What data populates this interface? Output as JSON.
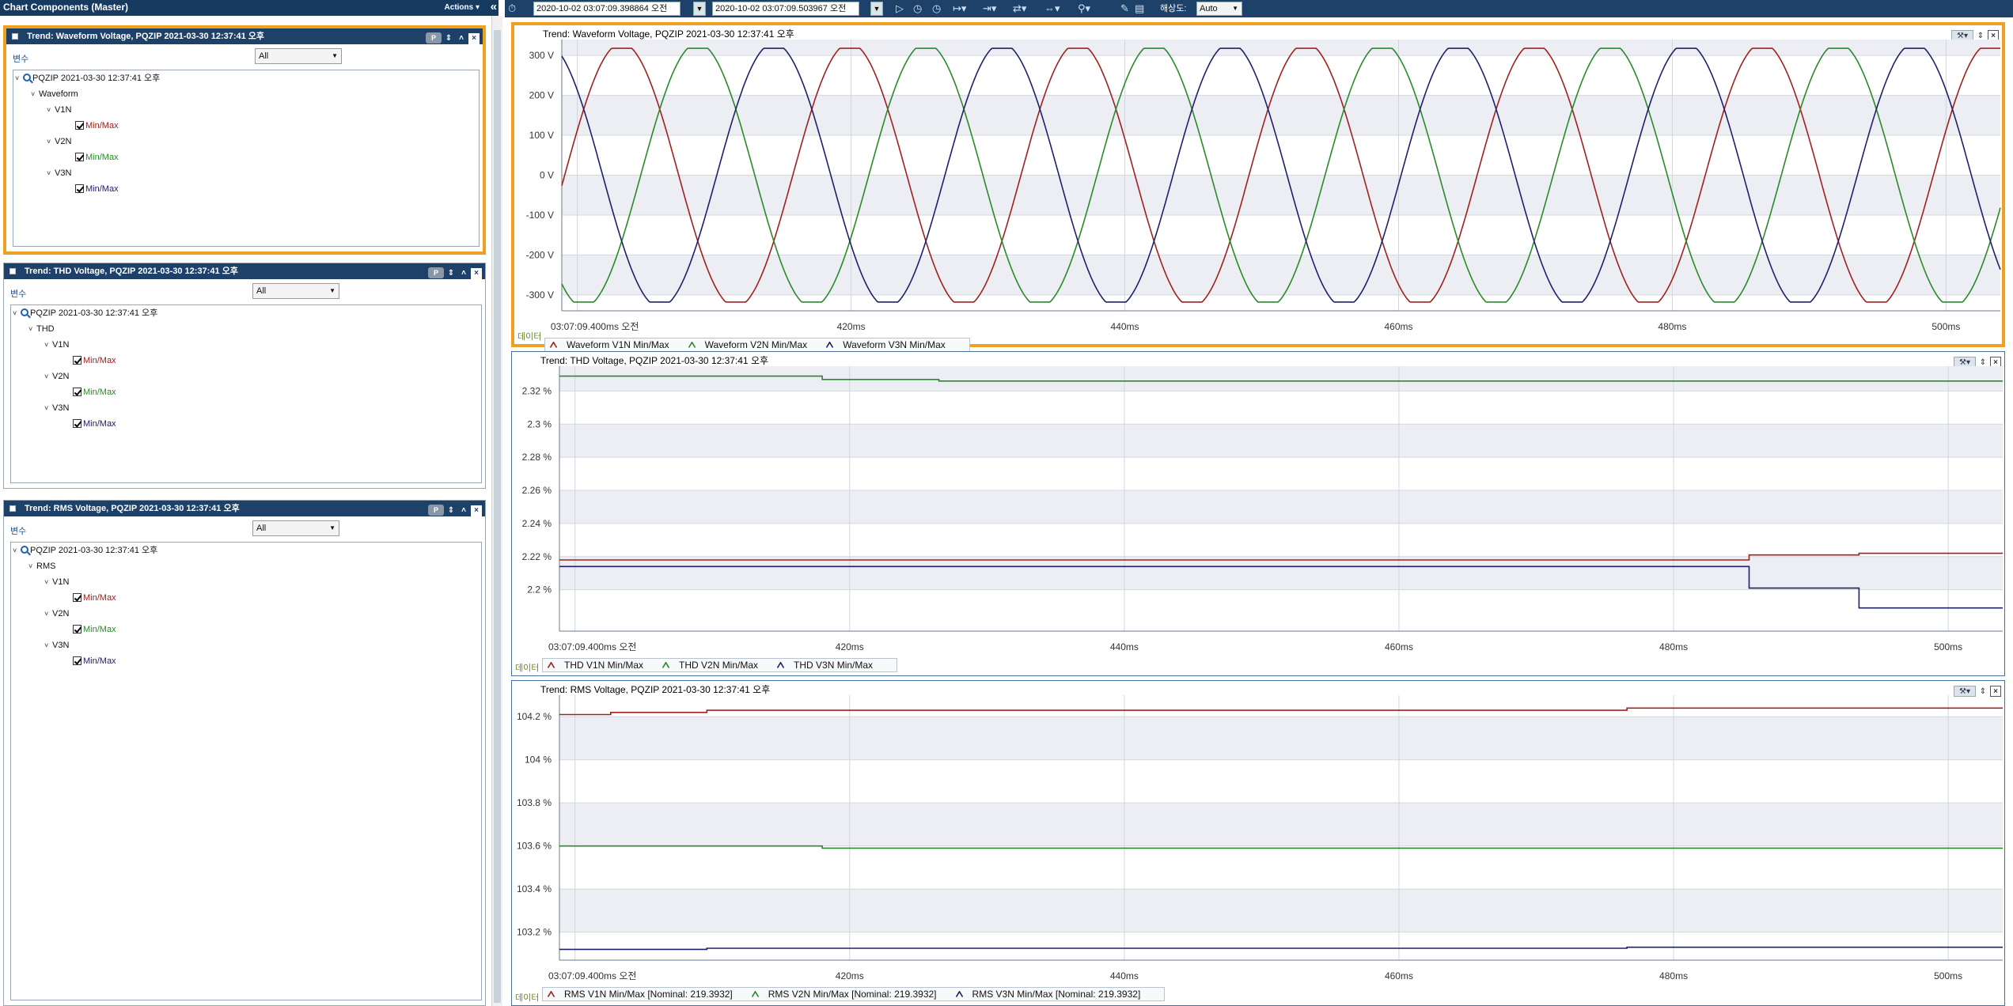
{
  "left_panel": {
    "title": "Chart Components (Master)",
    "actions_label": "Actions ▾",
    "collapse_icon": "«",
    "panels": [
      {
        "title": "Trend: Waveform Voltage, PQZIP 2021-03-30 12:37:41 오후",
        "variable_label": "변수",
        "filter": "All",
        "root": "PQZIP 2021-03-30 12:37:41 오후",
        "group": "Waveform",
        "channels": [
          {
            "name": "V1N",
            "item": "Min/Max",
            "color": "#a02020"
          },
          {
            "name": "V2N",
            "item": "Min/Max",
            "color": "#2a8a2a"
          },
          {
            "name": "V3N",
            "item": "Min/Max",
            "color": "#20206a"
          }
        ]
      },
      {
        "title": "Trend: THD Voltage, PQZIP 2021-03-30 12:37:41 오후",
        "variable_label": "변수",
        "filter": "All",
        "root": "PQZIP 2021-03-30 12:37:41 오후",
        "group": "THD",
        "channels": [
          {
            "name": "V1N",
            "item": "Min/Max",
            "color": "#a02020"
          },
          {
            "name": "V2N",
            "item": "Min/Max",
            "color": "#2a8a2a"
          },
          {
            "name": "V3N",
            "item": "Min/Max",
            "color": "#20206a"
          }
        ]
      },
      {
        "title": "Trend: RMS Voltage, PQZIP 2021-03-30 12:37:41 오후",
        "variable_label": "변수",
        "filter": "All",
        "root": "PQZIP 2021-03-30 12:37:41 오후",
        "group": "RMS",
        "channels": [
          {
            "name": "V1N",
            "item": "Min/Max",
            "color": "#a02020"
          },
          {
            "name": "V2N",
            "item": "Min/Max",
            "color": "#2a8a2a"
          },
          {
            "name": "V3N",
            "item": "Min/Max",
            "color": "#20206a"
          }
        ]
      }
    ]
  },
  "toolbar": {
    "start_time": "2020-10-02 03:07:09.398864 오전",
    "end_time": "2020-10-02 03:07:09.503967 오전",
    "resolution_label": "해상도:",
    "resolution_value": "Auto",
    "icons": [
      "clock-icon",
      "play-icon",
      "timer-icon",
      "stopwatch-icon",
      "cursor-step-icon",
      "cursor-add-icon",
      "cursor-move-icon",
      "cursor-range-icon",
      "zoom-icon",
      "pen-icon",
      "ruler-icon"
    ]
  },
  "colors": {
    "v1n": "#a02020",
    "v2n": "#2a8a2a",
    "v3n": "#20206a",
    "grid_band": "#eceef3",
    "selected_border": "#f0a020",
    "header": "#1d4169"
  },
  "data_tab_label": "데이터",
  "x_axis": {
    "first_tick_label": "03:07:09.400ms 오전",
    "tick_labels": [
      "420ms",
      "440ms",
      "460ms",
      "480ms",
      "500ms"
    ]
  },
  "chart_data": [
    {
      "type": "line",
      "title": "Trend: Waveform Voltage, PQZIP 2021-03-30 12:37:41 오후",
      "xlabel": "",
      "ylabel": "",
      "x_unit": "ms",
      "xlim": [
        398.864,
        503.967
      ],
      "ylim": [
        -340,
        340
      ],
      "yticks": [
        -300,
        -200,
        -100,
        0,
        100,
        200,
        300
      ],
      "ytick_labels": [
        "-300 V",
        "-200 V",
        "-100 V",
        "0 V",
        "100 V",
        "200 V",
        "300 V"
      ],
      "legend": [
        "Waveform V1N Min/Max",
        "Waveform V2N Min/Max",
        "Waveform V3N Min/Max"
      ],
      "series": [
        {
          "name": "Waveform V1N Min/Max",
          "shape": "sine",
          "amplitude_V": 318,
          "frequency_Hz": 60,
          "phase_deg": 20
        },
        {
          "name": "Waveform V2N Min/Max",
          "shape": "sine",
          "amplitude_V": 318,
          "frequency_Hz": 60,
          "phase_deg": -100
        },
        {
          "name": "Waveform V3N Min/Max",
          "shape": "sine",
          "amplitude_V": 318,
          "frequency_Hz": 60,
          "phase_deg": 140
        }
      ],
      "grid": true,
      "legend_position": "bottom-left"
    },
    {
      "type": "line",
      "title": "Trend: THD Voltage, PQZIP 2021-03-30 12:37:41 오후",
      "xlabel": "",
      "ylabel": "",
      "x_unit": "ms",
      "xlim": [
        398.864,
        503.967
      ],
      "ylim": [
        2.175,
        2.335
      ],
      "yticks": [
        2.2,
        2.22,
        2.24,
        2.26,
        2.28,
        2.3,
        2.32
      ],
      "ytick_labels": [
        "2.2 %",
        "2.22 %",
        "2.24 %",
        "2.26 %",
        "2.28 %",
        "2.3 %",
        "2.32 %"
      ],
      "legend": [
        "THD V1N Min/Max",
        "THD V2N Min/Max",
        "THD V3N Min/Max"
      ],
      "series": [
        {
          "name": "THD V1N Min/Max",
          "steps": [
            [
              398.864,
              2.218
            ],
            [
              485.5,
              2.221
            ],
            [
              493.5,
              2.222
            ],
            [
              503.967,
              2.222
            ]
          ]
        },
        {
          "name": "THD V2N Min/Max",
          "steps": [
            [
              398.864,
              2.329
            ],
            [
              418.0,
              2.327
            ],
            [
              426.5,
              2.326
            ],
            [
              503.967,
              2.326
            ]
          ]
        },
        {
          "name": "THD V3N Min/Max",
          "steps": [
            [
              398.864,
              2.214
            ],
            [
              485.5,
              2.201
            ],
            [
              493.5,
              2.189
            ],
            [
              503.967,
              2.189
            ]
          ]
        }
      ],
      "grid": true,
      "legend_position": "bottom-left"
    },
    {
      "type": "line",
      "title": "Trend: RMS Voltage, PQZIP 2021-03-30 12:37:41 오후",
      "xlabel": "",
      "ylabel": "",
      "x_unit": "ms",
      "xlim": [
        398.864,
        503.967
      ],
      "ylim": [
        103.07,
        104.3
      ],
      "yticks": [
        103.2,
        103.4,
        103.6,
        103.8,
        104,
        104.2
      ],
      "ytick_labels": [
        "103.2 %",
        "103.4 %",
        "103.6 %",
        "103.8 %",
        "104 %",
        "104.2 %"
      ],
      "legend": [
        "RMS V1N Min/Max [Nominal: 219.3932]",
        "RMS V2N Min/Max [Nominal: 219.3932]",
        "RMS V3N Min/Max [Nominal: 219.3932]"
      ],
      "series": [
        {
          "name": "RMS V1N Min/Max [Nominal: 219.3932]",
          "steps": [
            [
              398.864,
              104.21
            ],
            [
              402.6,
              104.22
            ],
            [
              409.6,
              104.23
            ],
            [
              476.6,
              104.24
            ],
            [
              503.967,
              104.24
            ]
          ]
        },
        {
          "name": "RMS V2N Min/Max [Nominal: 219.3932]",
          "steps": [
            [
              398.864,
              103.6
            ],
            [
              418.0,
              103.59
            ],
            [
              426.5,
              103.59
            ],
            [
              503.967,
              103.59
            ]
          ]
        },
        {
          "name": "RMS V3N Min/Max [Nominal: 219.3932]",
          "steps": [
            [
              398.864,
              103.12
            ],
            [
              409.6,
              103.125
            ],
            [
              476.6,
              103.13
            ],
            [
              503.967,
              103.13
            ]
          ]
        }
      ],
      "grid": true,
      "legend_position": "bottom-left"
    }
  ]
}
